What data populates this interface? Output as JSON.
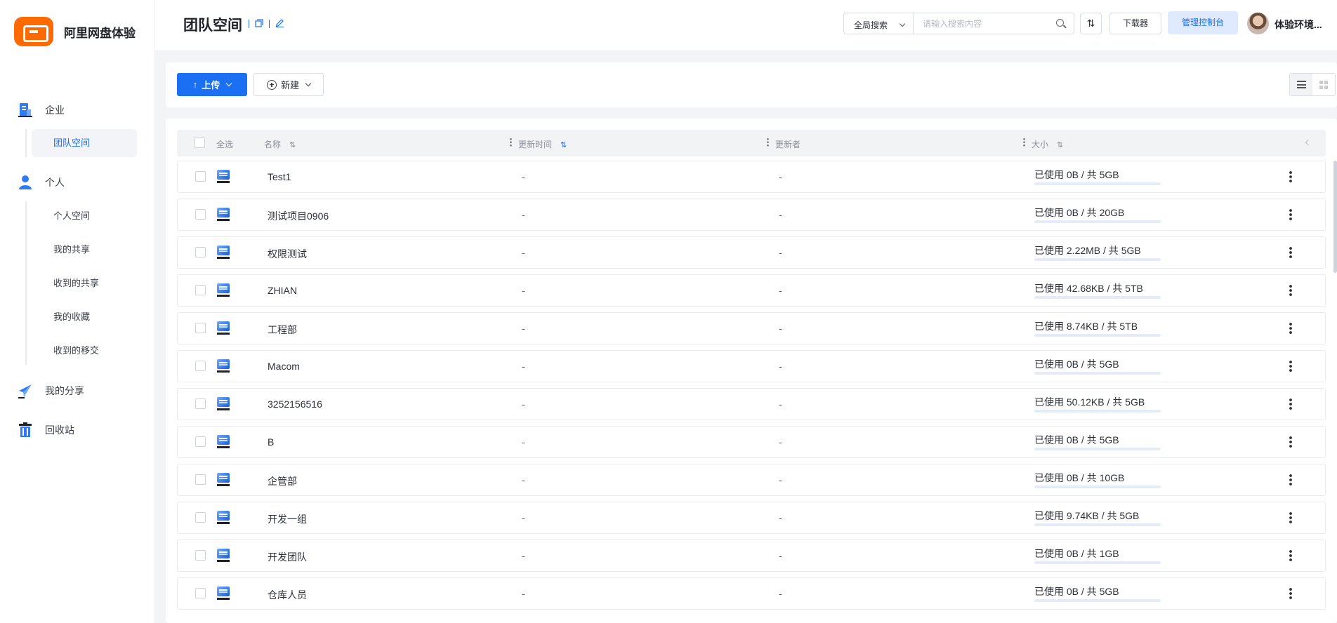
{
  "app": {
    "name": "阿里网盘体验"
  },
  "sidebar": {
    "enterprise_label": "企业",
    "team_space_label": "团队空间",
    "personal_label": "个人",
    "personal_items": [
      "个人空间",
      "我的共享",
      "收到的共享",
      "我的收藏",
      "收到的移交"
    ],
    "my_shares_label": "我的分享",
    "recycle_label": "回收站"
  },
  "header": {
    "title": "团队空间",
    "scope": "全局搜索",
    "search_placeholder": "请输入搜索内容",
    "sort_glyph": "⇅",
    "download_label": "下载器",
    "admin_label": "管理控制台",
    "user_name": "体验环境..."
  },
  "toolbar": {
    "upload_label": "上传",
    "upload_arrow": "↑",
    "new_label": "新建"
  },
  "table": {
    "columns": {
      "select_all": "全选",
      "name": "名称",
      "updated_time": "更新时间",
      "updater": "更新者",
      "size": "大小"
    },
    "sort_glyph": "⇅",
    "rows": [
      {
        "name": "Test1",
        "time": "-",
        "updater": "-",
        "size": "已使用 0B / 共 5GB",
        "usage": 0
      },
      {
        "name": "测试项目0906",
        "time": "-",
        "updater": "-",
        "size": "已使用 0B / 共 20GB",
        "usage": 0
      },
      {
        "name": "权限测试",
        "time": "-",
        "updater": "-",
        "size": "已使用 2.22MB / 共 5GB",
        "usage": 0.0004
      },
      {
        "name": "ZHIAN",
        "time": "-",
        "updater": "-",
        "size": "已使用 42.68KB / 共 5TB",
        "usage": 0
      },
      {
        "name": "工程部",
        "time": "-",
        "updater": "-",
        "size": "已使用 8.74KB / 共 5TB",
        "usage": 0
      },
      {
        "name": "Macom",
        "time": "-",
        "updater": "-",
        "size": "已使用 0B / 共 5GB",
        "usage": 0
      },
      {
        "name": "3252156516",
        "time": "-",
        "updater": "-",
        "size": "已使用 50.12KB / 共 5GB",
        "usage": 0
      },
      {
        "name": "B",
        "time": "-",
        "updater": "-",
        "size": "已使用 0B / 共 5GB",
        "usage": 0
      },
      {
        "name": "企管部",
        "time": "-",
        "updater": "-",
        "size": "已使用 0B / 共 10GB",
        "usage": 0
      },
      {
        "name": "开发一组",
        "time": "-",
        "updater": "-",
        "size": "已使用 9.74KB / 共 5GB",
        "usage": 0
      },
      {
        "name": "开发团队",
        "time": "-",
        "updater": "-",
        "size": "已使用 0B / 共 1GB",
        "usage": 0
      },
      {
        "name": "仓库人员",
        "time": "-",
        "updater": "-",
        "size": "已使用 0B / 共 5GB",
        "usage": 0
      }
    ]
  },
  "colors": {
    "accent": "#1a6ff2",
    "brand": "#ff6a00"
  }
}
